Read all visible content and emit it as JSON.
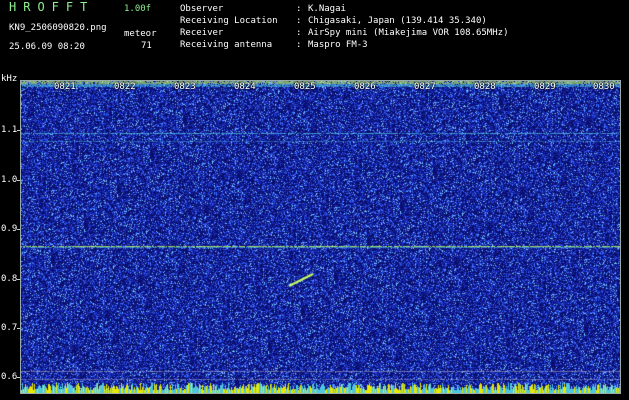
{
  "header": {
    "app_title": "HROFFT",
    "version": "1.00f",
    "filename": "KN9_2506090820.png",
    "datetime": "25.06.09 08:20",
    "meteor_label": "meteor",
    "meteor_count": "71"
  },
  "meta": [
    {
      "key": "Observer",
      "value": "K.Nagai"
    },
    {
      "key": "Receiving Location",
      "value": "Chigasaki, Japan (139.414 35.340)"
    },
    {
      "key": "Receiver",
      "value": "AirSpy mini (Miakejima VOR 108.65MHz)"
    },
    {
      "key": "Receiving antenna",
      "value": "Maspro FM-3"
    }
  ],
  "meta_separator": ":",
  "axis": {
    "y_unit": "kHz",
    "y_ticks": [
      "1.1",
      "1.0",
      "0.9",
      "0.8",
      "0.7",
      "0.6"
    ],
    "time_ticks": [
      "0821",
      "0822",
      "0823",
      "0824",
      "0825",
      "0826",
      "0827",
      "0828",
      "0829",
      "0830"
    ]
  },
  "colors": {
    "background": "#0a0f6e",
    "noise": "#3a5cff",
    "carrier": "#4ec8e0",
    "echo": "#c8ff60",
    "bottom_band": "#e8e800"
  }
}
